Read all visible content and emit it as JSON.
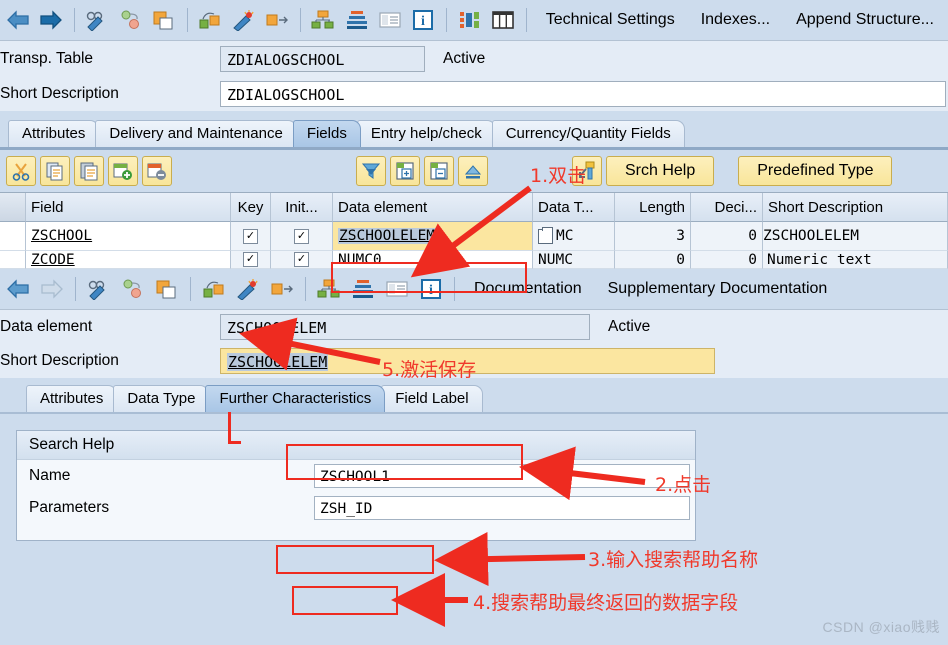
{
  "top_toolbar": {
    "icons": [
      {
        "name": "back-arrow-icon",
        "glyph": "←"
      },
      {
        "name": "forward-arrow-icon",
        "glyph": "→"
      },
      {
        "name": "display-change-icon",
        "glyph": "glasses-pencil"
      },
      {
        "name": "where-used-list-icon",
        "glyph": "tree-nodes"
      },
      {
        "name": "copy-object-icon",
        "glyph": "copy-page"
      },
      {
        "name": "check-icon",
        "glyph": "check-box"
      },
      {
        "name": "activate-icon",
        "glyph": "magic-wand"
      },
      {
        "name": "expand-icon",
        "glyph": "expand-arrows"
      },
      {
        "name": "hierarchy-icon",
        "glyph": "hierarchy"
      },
      {
        "name": "stack-icon",
        "glyph": "stack"
      },
      {
        "name": "list-icon",
        "glyph": "list"
      },
      {
        "name": "information-icon",
        "glyph": "i"
      },
      {
        "name": "structure-icon",
        "glyph": "blocks"
      },
      {
        "name": "table-columns-icon",
        "glyph": "columns"
      }
    ],
    "buttons": [
      "Technical Settings",
      "Indexes...",
      "Append Structure..."
    ]
  },
  "header_form": {
    "table_label": "Transp. Table",
    "table_value": "ZDIALOGSCHOOL",
    "table_status": "Active",
    "desc_label": "Short Description",
    "desc_value": "ZDIALOGSCHOOL"
  },
  "main_tabs": {
    "items": [
      "Attributes",
      "Delivery and Maintenance",
      "Fields",
      "Entry help/check",
      "Currency/Quantity Fields"
    ],
    "active": "Fields"
  },
  "grid_toolbar": {
    "icons": [
      {
        "name": "cut-icon",
        "glyph": "scissors"
      },
      {
        "name": "copy-icon",
        "glyph": "copy"
      },
      {
        "name": "paste-icon",
        "glyph": "paste"
      },
      {
        "name": "insert-row-icon",
        "glyph": "row-plus"
      },
      {
        "name": "delete-row-icon",
        "glyph": "row-minus"
      },
      {
        "name": "filter-icon",
        "glyph": "funnel"
      },
      {
        "name": "expand-all-icon",
        "glyph": "box-plus"
      },
      {
        "name": "collapse-all-icon",
        "glyph": "box-minus"
      },
      {
        "name": "sort-icon",
        "glyph": "sort-up"
      },
      {
        "name": "data-element-icon",
        "glyph": "key-arrow"
      }
    ],
    "buttons": [
      "Srch Help",
      "Predefined Type"
    ]
  },
  "field_grid": {
    "columns": [
      "Field",
      "Key",
      "Init...",
      "Data element",
      "Data T...",
      "Length",
      "Deci...",
      "Short Description"
    ],
    "rows": [
      {
        "field": "ZSCHOOL",
        "key": "✓",
        "init": "✓",
        "data_element": "ZSCHOOLELEM",
        "data_type": "MC",
        "length": "3",
        "decimals": "0",
        "short_description": "ZSCHOOLELEM"
      },
      {
        "field": "ZCODE",
        "key": "✓",
        "init": "✓",
        "data_element": "NUMC0",
        "data_type": "NUMC",
        "length": "0",
        "decimals": "0",
        "short_description": "Numeric text"
      }
    ]
  },
  "detail_toolbar": {
    "icons": [
      {
        "name": "back-arrow-icon",
        "glyph": "←"
      },
      {
        "name": "forward-arrow-icon-disabled",
        "glyph": "→"
      },
      {
        "name": "display-change-icon",
        "glyph": "glasses-pencil"
      },
      {
        "name": "where-used-list-icon",
        "glyph": "tree-nodes"
      },
      {
        "name": "copy-object-icon",
        "glyph": "copy-page"
      },
      {
        "name": "check-icon",
        "glyph": "check-box"
      },
      {
        "name": "activate-icon",
        "glyph": "magic-wand"
      },
      {
        "name": "expand-icon",
        "glyph": "expand-arrows"
      },
      {
        "name": "hierarchy-icon",
        "glyph": "hierarchy"
      },
      {
        "name": "stack-icon",
        "glyph": "stack"
      },
      {
        "name": "list-icon",
        "glyph": "list"
      },
      {
        "name": "information-icon",
        "glyph": "i"
      }
    ],
    "buttons": [
      "Documentation",
      "Supplementary Documentation"
    ]
  },
  "detail_form": {
    "element_label": "Data element",
    "element_value": "ZSCHOOLELEM",
    "element_status": "Active",
    "desc_label": "Short Description",
    "desc_value": "ZSCHOOLELEM"
  },
  "detail_tabs": {
    "items": [
      "Attributes",
      "Data Type",
      "Further Characteristics",
      "Field Label"
    ],
    "active": "Further Characteristics"
  },
  "search_help": {
    "title": "Search Help",
    "name_label": "Name",
    "name_value": "ZSCHOOL1",
    "params_label": "Parameters",
    "params_value": "ZSH_ID"
  },
  "annotations": [
    {
      "id": "a1",
      "text": "1.双击"
    },
    {
      "id": "a2",
      "text": "2.点击"
    },
    {
      "id": "a3",
      "text": "3.输入搜索帮助名称"
    },
    {
      "id": "a4",
      "text": "4.搜索帮助最终返回的数据字段"
    },
    {
      "id": "a5",
      "text": "5.激活保存"
    }
  ],
  "watermark": "CSDN @xiao贱贱",
  "colors": {
    "accent": "#f0392b",
    "panel": "#cddced",
    "field_highlight": "#fbe6a0",
    "tab_active": "#a9c6e6"
  }
}
